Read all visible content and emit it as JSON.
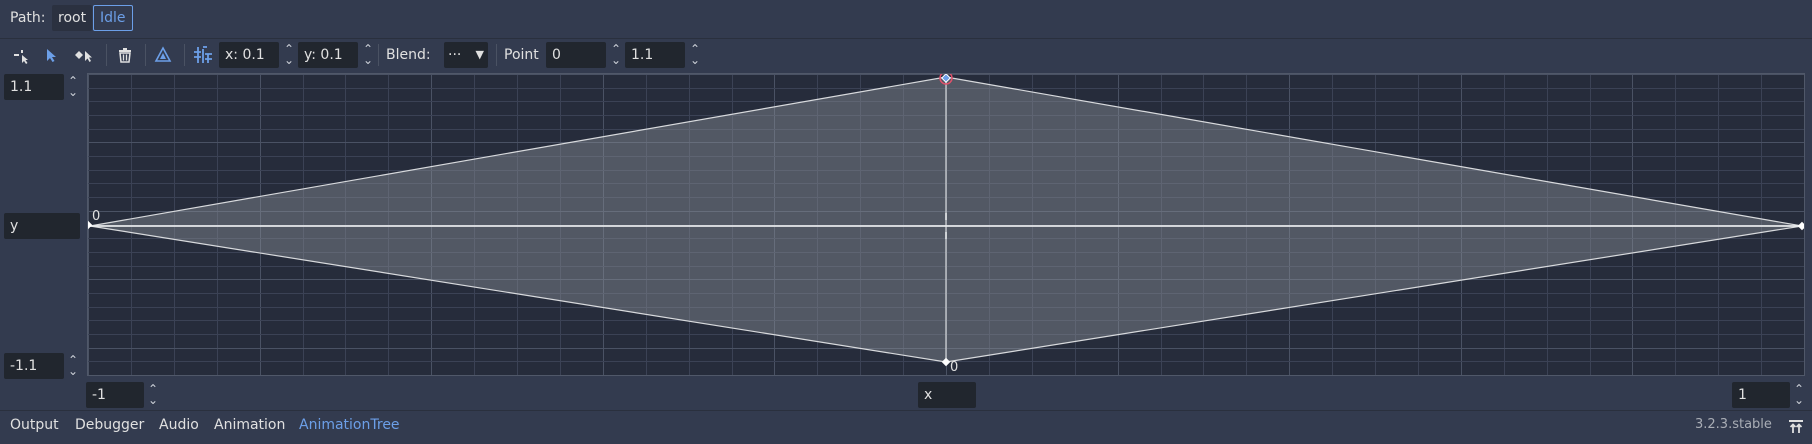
{
  "path": {
    "label": "Path:",
    "crumbs": [
      "root",
      "Idle"
    ]
  },
  "toolbar": {
    "snap_x_label": "x: 0.1",
    "snap_y_label": "y: 0.1",
    "blend_label": "Blend:",
    "blend_value": "···",
    "point_label": "Point",
    "point_x": "0",
    "point_y": "1.1"
  },
  "editor": {
    "max_y": "1.1",
    "min_y": "-1.1",
    "y_label": "y",
    "min_x": "-1",
    "max_x": "1",
    "x_label": "x",
    "point_labels": [
      "0",
      "0"
    ]
  },
  "bottom": {
    "tabs": [
      "Output",
      "Debugger",
      "Audio",
      "Animation",
      "AnimationTree"
    ],
    "active_tab": "AnimationTree",
    "version": "3.2.3.stable"
  },
  "colors": {
    "accent": "#6c9fe8",
    "background": "#333b4f",
    "canvas": "#262c3b",
    "selected_point": "#e0506a"
  }
}
